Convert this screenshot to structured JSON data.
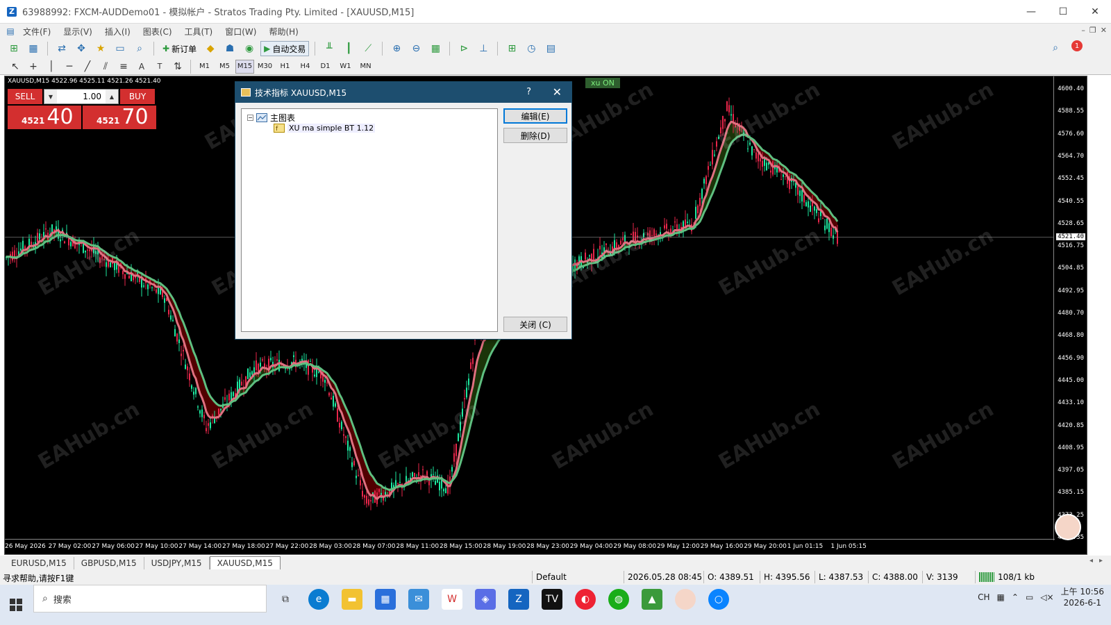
{
  "window": {
    "title": "63988992: FXCM-AUDDemo01 - 模拟帐户 - Stratos Trading Pty. Limited - [XAUUSD,M15]",
    "icon_letter": "Z",
    "minimize": "—",
    "maximize": "☐",
    "close": "✕"
  },
  "menu": [
    "文件(F)",
    "显示(V)",
    "插入(I)",
    "图表(C)",
    "工具(T)",
    "窗口(W)",
    "帮助(H)"
  ],
  "toolbar": {
    "new_order": "新订单",
    "auto_trade": "自动交易",
    "notification_count": "1"
  },
  "timeframes": [
    "M1",
    "M5",
    "M15",
    "M30",
    "H1",
    "H4",
    "D1",
    "W1",
    "MN"
  ],
  "active_timeframe": "M15",
  "chart": {
    "ohlc": "XAUUSD,M15  4522.96 4525.11 4521.26 4521.40",
    "indicator_badge": "xu ON",
    "current_price": "4521.40",
    "price_labels": [
      "4600.40",
      "4588.55",
      "4576.60",
      "4564.70",
      "4552.45",
      "4540.55",
      "4528.65",
      "4516.75",
      "4504.85",
      "4492.95",
      "4480.70",
      "4468.80",
      "4456.90",
      "4445.00",
      "4433.10",
      "4420.85",
      "4408.95",
      "4397.05",
      "4385.15",
      "4373.25",
      "4361.35"
    ],
    "time_labels": [
      "26 May 2026",
      "27 May 02:00",
      "27 May 06:00",
      "27 May 10:00",
      "27 May 14:00",
      "27 May 18:00",
      "27 May 22:00",
      "28 May 03:00",
      "28 May 07:00",
      "28 May 11:00",
      "28 May 15:00",
      "28 May 19:00",
      "28 May 23:00",
      "29 May 04:00",
      "29 May 08:00",
      "29 May 12:00",
      "29 May 16:00",
      "29 May 20:00",
      "1 Jun 01:15",
      "1 Jun 05:15"
    ],
    "watermark": "EAHub.cn",
    "colors": {
      "bull": "#1de9a0",
      "bear": "#e8264a",
      "ma": "#5fbf80",
      "fill_down": "#5a0000",
      "fill_up": "#1e3a0a"
    }
  },
  "trade_panel": {
    "sell_label": "SELL",
    "buy_label": "BUY",
    "lot": "1.00",
    "sell_prefix": "4521",
    "sell_big": "40",
    "buy_prefix": "4521",
    "buy_big": "70"
  },
  "dialog": {
    "title": "技术指标 XAUUSD,M15",
    "help": "?",
    "close": "✕",
    "tree_root": "主图表",
    "tree_child": "XU ma simple BT 1.12",
    "edit_button": "编辑(E)",
    "delete_button": "删除(D)",
    "close_button": "关闭 (C)"
  },
  "tabs": [
    "EURUSD,M15",
    "GBPUSD,M15",
    "USDJPY,M15",
    "XAUUSD,M15"
  ],
  "active_tab": "XAUUSD,M15",
  "status": {
    "help": "寻求帮助,请按F1键",
    "profile": "Default",
    "datetime": "2026.05.28 08:45",
    "open": "O: 4389.51",
    "high": "H: 4395.56",
    "low": "L: 4387.53",
    "close": "C: 4388.00",
    "volume": "V: 3139",
    "traffic": "108/1 kb"
  },
  "taskbar": {
    "search": "搜索",
    "tray_lang": "CH",
    "time": "上午 10:56",
    "date": "2026-6-1"
  }
}
